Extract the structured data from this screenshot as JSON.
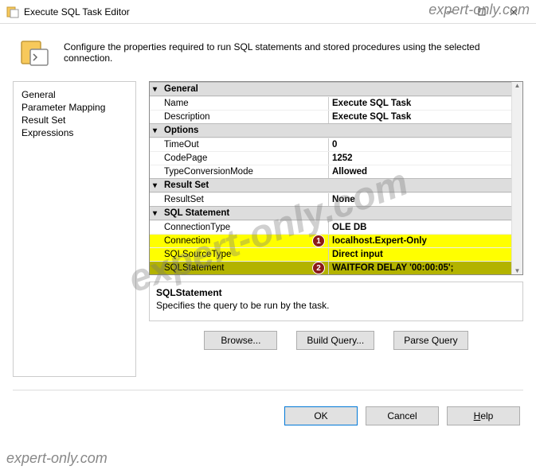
{
  "watermark": "expert-only.com",
  "window": {
    "title": "Execute SQL Task Editor"
  },
  "header": {
    "desc": "Configure the properties required to run SQL statements and stored procedures using the selected connection."
  },
  "sidebar": {
    "items": [
      "General",
      "Parameter Mapping",
      "Result Set",
      "Expressions"
    ]
  },
  "grid": {
    "cat_general": "General",
    "name_label": "Name",
    "name_val": "Execute SQL Task",
    "desc_label": "Description",
    "desc_val": "Execute SQL Task",
    "cat_options": "Options",
    "timeout_label": "TimeOut",
    "timeout_val": "0",
    "codepage_label": "CodePage",
    "codepage_val": "1252",
    "typeconv_label": "TypeConversionMode",
    "typeconv_val": "Allowed",
    "cat_resultset": "Result Set",
    "resultset_label": "ResultSet",
    "resultset_val": "None",
    "cat_sqlstmt": "SQL Statement",
    "conntype_label": "ConnectionType",
    "conntype_val": "OLE DB",
    "conn_label": "Connection",
    "conn_val": "localhost.Expert-Only",
    "sqlsrc_label": "SQLSourceType",
    "sqlsrc_val": "Direct input",
    "sqlstmt_label": "SQLStatement",
    "sqlstmt_val": "WAITFOR DELAY '00:00:05';"
  },
  "markers": {
    "m1": "1",
    "m2": "2"
  },
  "help": {
    "title": "SQLStatement",
    "text": "Specifies the query to be run by the task."
  },
  "actions": {
    "browse": "Browse...",
    "build": "Build Query...",
    "parse": "Parse Query"
  },
  "footer": {
    "ok": "OK",
    "cancel": "Cancel",
    "help_pre": "H",
    "help_post": "elp"
  }
}
